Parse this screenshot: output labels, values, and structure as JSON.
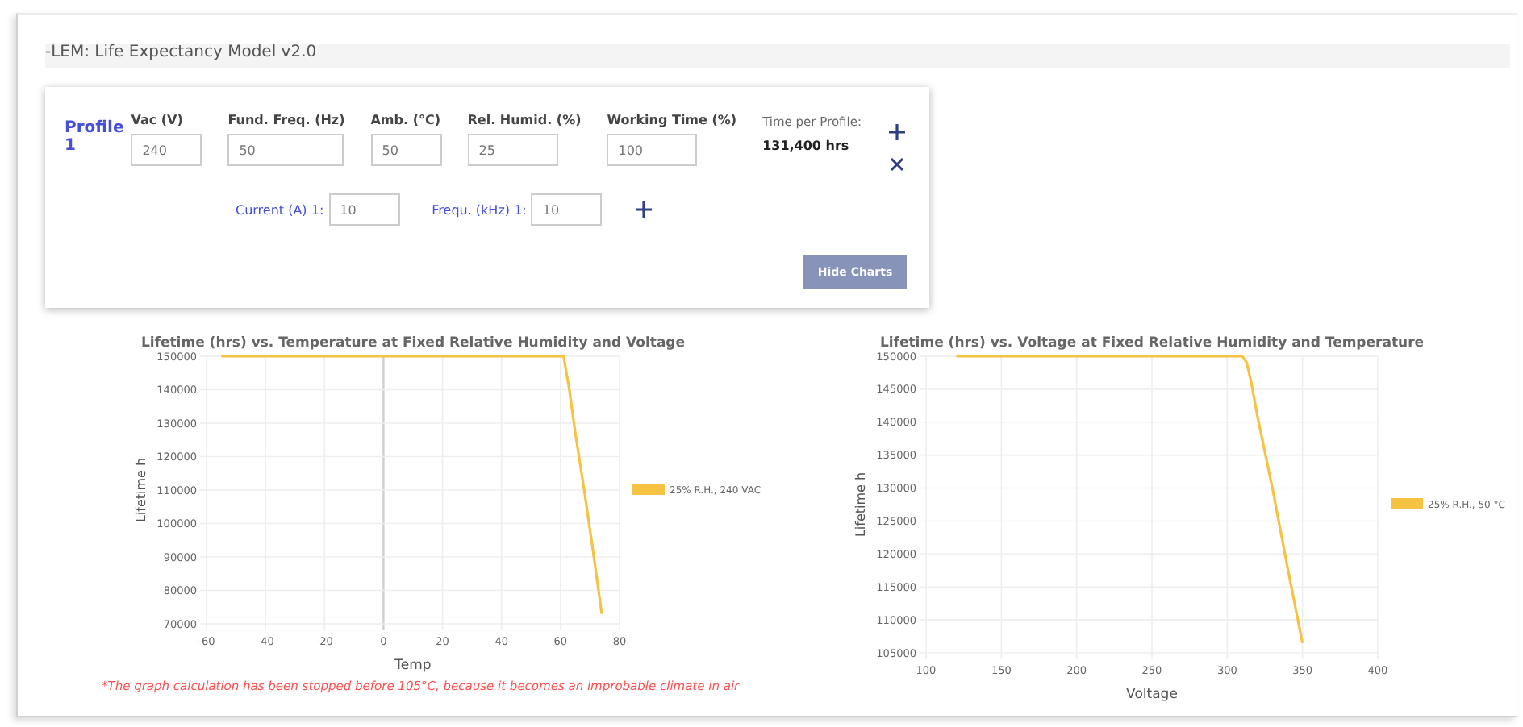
{
  "header": {
    "title": "-LEM: Life Expectancy Model v2.0"
  },
  "profile": {
    "title": "Profile 1",
    "fields": [
      {
        "label": "Vac (V)",
        "value": "240"
      },
      {
        "label": "Fund. Freq. (Hz)",
        "value": "50"
      },
      {
        "label": "Amb. (°C)",
        "value": "50"
      },
      {
        "label": "Rel. Humid. (%)",
        "value": "25"
      },
      {
        "label": "Working Time (%)",
        "value": "100"
      }
    ],
    "time_label": "Time per Profile:",
    "time_value": "131,400 hrs",
    "harmonics": [
      {
        "label": "Current (A) 1:",
        "value": "10"
      },
      {
        "label": "Frequ. (kHz) 1:",
        "value": "10"
      }
    ],
    "button": "Hide Charts"
  },
  "charts": [
    {
      "chart_data": {
        "type": "line",
        "title": "Lifetime (hrs) vs. Temperature at Fixed Relative Humidity and Voltage",
        "xlabel": "Temp",
        "ylabel": "Lifetime h",
        "grid": true,
        "x": [
          -55,
          -40,
          -20,
          0,
          20,
          40,
          60,
          61,
          63,
          65,
          68,
          71,
          74
        ],
        "xlim": [
          -60,
          80
        ],
        "ylim": [
          70000,
          150000
        ],
        "xticks": [
          -60,
          -40,
          -20,
          0,
          20,
          40,
          60,
          80
        ],
        "yticks": [
          70000,
          80000,
          90000,
          100000,
          110000,
          120000,
          130000,
          140000,
          150000
        ],
        "series": [
          {
            "name": "25% R.H., 240 VAC",
            "color": "#f5c242",
            "values": [
              150000,
              150000,
              150000,
              150000,
              150000,
              150000,
              150000,
              150000,
              140000,
              127000,
              110000,
              92000,
              73000
            ]
          }
        ]
      },
      "note": "*The graph calculation has been stopped before 105°C, because it becomes an improbable climate in air"
    },
    {
      "chart_data": {
        "type": "line",
        "title": "Lifetime (hrs) vs. Voltage at Fixed Relative Humidity and Temperature",
        "xlabel": "Voltage",
        "ylabel": "Lifetime h",
        "grid": true,
        "x": [
          120,
          150,
          200,
          250,
          300,
          310,
          313,
          316,
          320,
          330,
          340,
          350
        ],
        "xlim": [
          100,
          400
        ],
        "ylim": [
          105000,
          150000
        ],
        "xticks": [
          100,
          150,
          200,
          250,
          300,
          350,
          400
        ],
        "yticks": [
          105000,
          110000,
          115000,
          120000,
          125000,
          130000,
          135000,
          140000,
          145000,
          150000
        ],
        "series": [
          {
            "name": "25% R.H., 50 °C",
            "color": "#f5c242",
            "values": [
              150000,
              150000,
              150000,
              150000,
              150000,
              150000,
              149000,
              146000,
              141000,
              130000,
              118000,
              106500
            ]
          }
        ]
      }
    }
  ]
}
